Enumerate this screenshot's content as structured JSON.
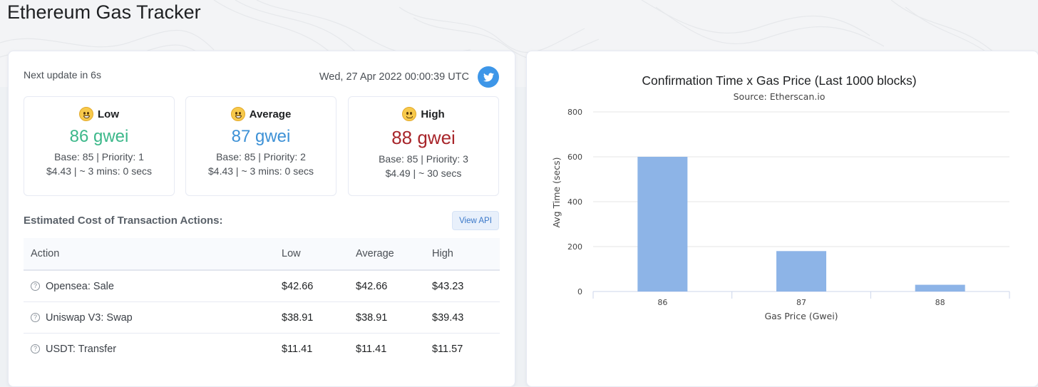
{
  "page": {
    "title": "Ethereum Gas Tracker"
  },
  "tracker": {
    "next_update": "Next update in 6s",
    "timestamp": "Wed, 27 Apr 2022 00:00:39 UTC",
    "share_icon": "twitter-icon"
  },
  "gas": {
    "low": {
      "label": "Low",
      "emoji": "grinning-face-icon",
      "price": "86 gwei",
      "base_priority": "Base: 85 | Priority: 1",
      "cost_time": "$4.43 | ~ 3 mins: 0 secs",
      "color": "#3cb88a"
    },
    "average": {
      "label": "Average",
      "emoji": "smiling-face-icon",
      "price": "87 gwei",
      "base_priority": "Base: 85 | Priority: 2",
      "cost_time": "$4.43 | ~ 3 mins: 0 secs",
      "color": "#3d91d6"
    },
    "high": {
      "label": "High",
      "emoji": "slightly-smiling-face-icon",
      "price": "88 gwei",
      "base_priority": "Base: 85 | Priority: 3",
      "cost_time": "$4.49 | ~ 30 secs",
      "color": "#a8262b"
    }
  },
  "estimates": {
    "title": "Estimated Cost of Transaction Actions:",
    "api_button": "View API",
    "columns": [
      "Action",
      "Low",
      "Average",
      "High"
    ],
    "rows": [
      {
        "action": "Opensea: Sale",
        "low": "$42.66",
        "average": "$42.66",
        "high": "$43.23"
      },
      {
        "action": "Uniswap V3: Swap",
        "low": "$38.91",
        "average": "$38.91",
        "high": "$39.43"
      },
      {
        "action": "USDT: Transfer",
        "low": "$11.41",
        "average": "$11.41",
        "high": "$11.57"
      }
    ]
  },
  "chart_data": {
    "type": "bar",
    "title": "Confirmation Time x Gas Price (Last 1000 blocks)",
    "subtitle": "Source: Etherscan.io",
    "xlabel": "Gas Price (Gwei)",
    "ylabel": "Avg Time (secs)",
    "categories": [
      "86",
      "87",
      "88"
    ],
    "values": [
      600,
      180,
      30
    ],
    "ylim": [
      0,
      800
    ],
    "yticks": [
      0,
      200,
      400,
      600,
      800
    ],
    "grid": true,
    "bar_color": "#8db4e7"
  }
}
